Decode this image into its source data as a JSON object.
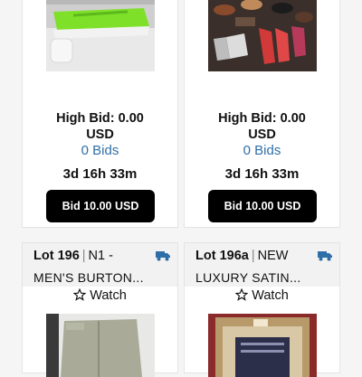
{
  "cards_top": [
    {
      "image_desc": "green sneakers in box",
      "high_bid": "High Bid: 0.00",
      "currency": "USD",
      "bids": "0 Bids",
      "time_left": "3d 16h 33m",
      "button": "Bid 10.00 USD"
    },
    {
      "image_desc": "assorted women's shoes",
      "high_bid": "High Bid: 0.00",
      "currency": "USD",
      "bids": "0 Bids",
      "time_left": "3d 16h 33m",
      "button": "Bid 10.00 USD"
    }
  ],
  "cards_bottom": [
    {
      "lot": "Lot 196",
      "sep": "|",
      "title1": "N1 -",
      "title2": "MEN'S BURTON...",
      "watch": "Watch",
      "icon": "truck-icon"
    },
    {
      "lot": "Lot 196a",
      "sep": "|",
      "title1": "NEW",
      "title2": "LUXURY SATIN...",
      "watch": "Watch",
      "icon": "truck-icon"
    }
  ],
  "colors": {
    "link": "#2f6fa8",
    "truck": "#2f6fa8",
    "button": "#000000"
  }
}
